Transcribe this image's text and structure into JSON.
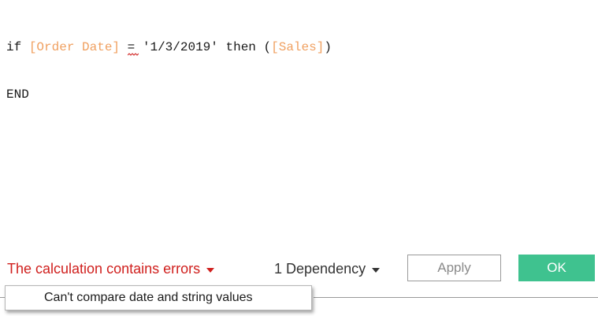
{
  "editor": {
    "line1": {
      "kw_if": "if",
      "field_order_date": "[Order Date]",
      "operator": "=",
      "string_literal": "'1/3/2019'",
      "kw_then": "then",
      "open_paren": "(",
      "field_sales": "[Sales]",
      "close_paren": ")"
    },
    "line2": {
      "kw_end": "END"
    }
  },
  "footer": {
    "error_status": "The calculation contains errors",
    "dependency": "1 Dependency",
    "apply_label": "Apply",
    "ok_label": "OK"
  },
  "tooltip": {
    "message": "Can't compare date and string values"
  },
  "colors": {
    "error": "#d0201e",
    "field": "#f0a060",
    "ok_button": "#3fc28f",
    "squiggle": "#d0201e"
  },
  "icons": {
    "error_dropdown": "caret-down-icon",
    "dependency_dropdown": "caret-down-icon",
    "error_underline": "squiggle-underline"
  }
}
